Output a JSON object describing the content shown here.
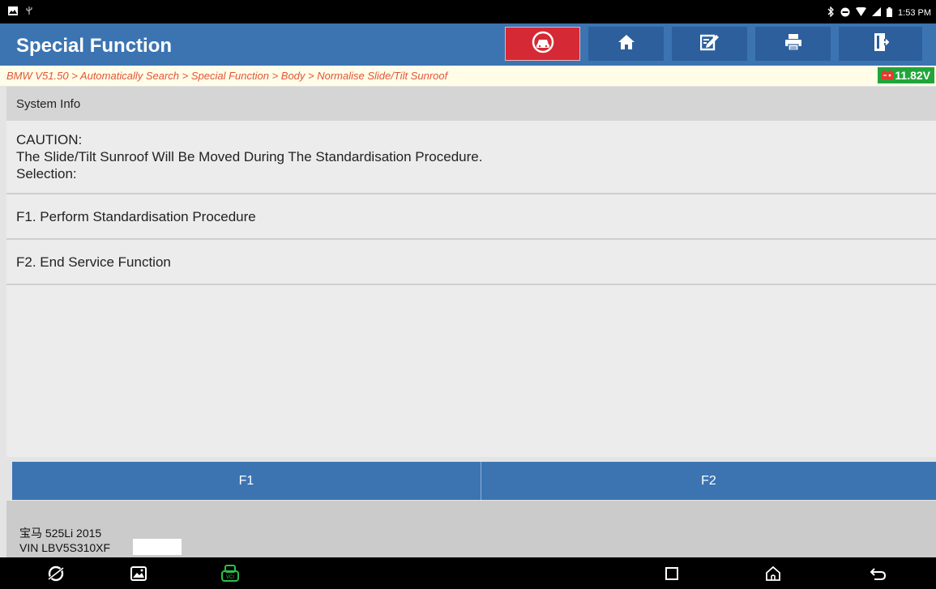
{
  "status_bar": {
    "time": "1:53 PM",
    "left_icons": [
      "image-notification-icon",
      "usb-icon"
    ],
    "right_icons": [
      "bluetooth-icon",
      "do-not-disturb-icon",
      "wifi-icon",
      "signal-icon",
      "battery-icon"
    ]
  },
  "header": {
    "title": "Special Function",
    "buttons": [
      "vehicle-diagnostic-icon",
      "home-icon",
      "edit-icon",
      "print-icon",
      "exit-icon"
    ]
  },
  "breadcrumb": {
    "path": "BMW V51.50 > Automatically Search > Special Function > Body > Normalise Slide/Tilt Sunroof",
    "voltage": "11.82V"
  },
  "section": {
    "label": "System Info"
  },
  "message": {
    "line1": "CAUTION:",
    "line2": "The Slide/Tilt Sunroof Will Be Moved During The Standardisation Procedure.",
    "line3": "Selection:"
  },
  "options": [
    {
      "label": "F1. Perform Standardisation Procedure"
    },
    {
      "label": "F2. End Service Function"
    }
  ],
  "function_buttons": [
    {
      "label": "F1"
    },
    {
      "label": "F2"
    }
  ],
  "vehicle": {
    "model": "宝马 525Li 2015",
    "vin": "VIN LBV5S310XF"
  },
  "colors": {
    "header_blue": "#3c74b2",
    "alert_red": "#d52a35",
    "breadcrumb_text": "#e2553a",
    "battery_green": "#21a53a"
  }
}
